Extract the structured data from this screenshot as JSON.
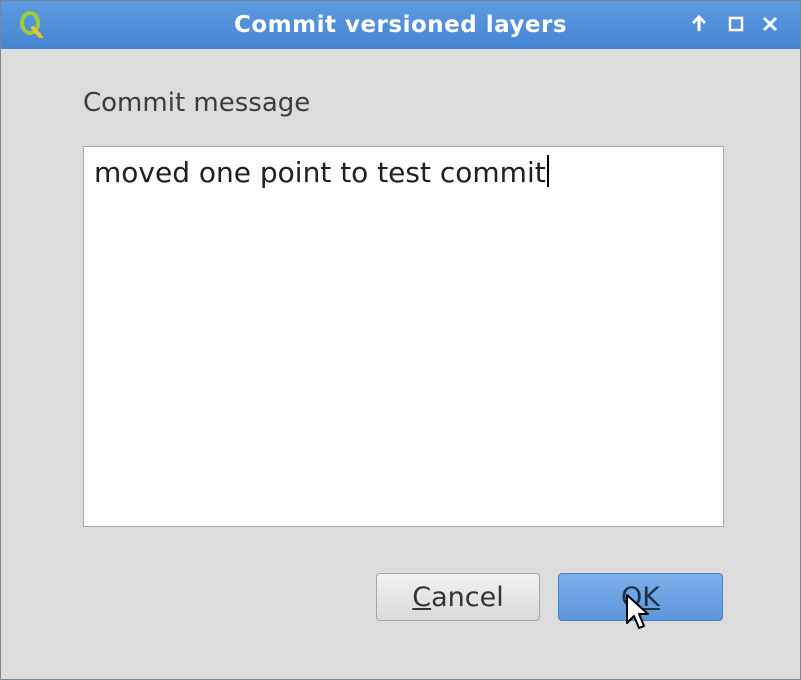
{
  "window": {
    "title": "Commit versioned layers",
    "app_icon": "qgis-icon",
    "controls": [
      "up-arrow-icon",
      "maximize-icon",
      "close-icon"
    ]
  },
  "form": {
    "label": "Commit message",
    "message_value": "moved one point to test commit"
  },
  "buttons": {
    "cancel_mnemonic": "C",
    "cancel_rest": "ancel",
    "ok_first": "O",
    "ok_mnemonic": "K"
  },
  "colors": {
    "titlebar": "#4a8bd6",
    "ok_button": "#6aa3e4"
  }
}
